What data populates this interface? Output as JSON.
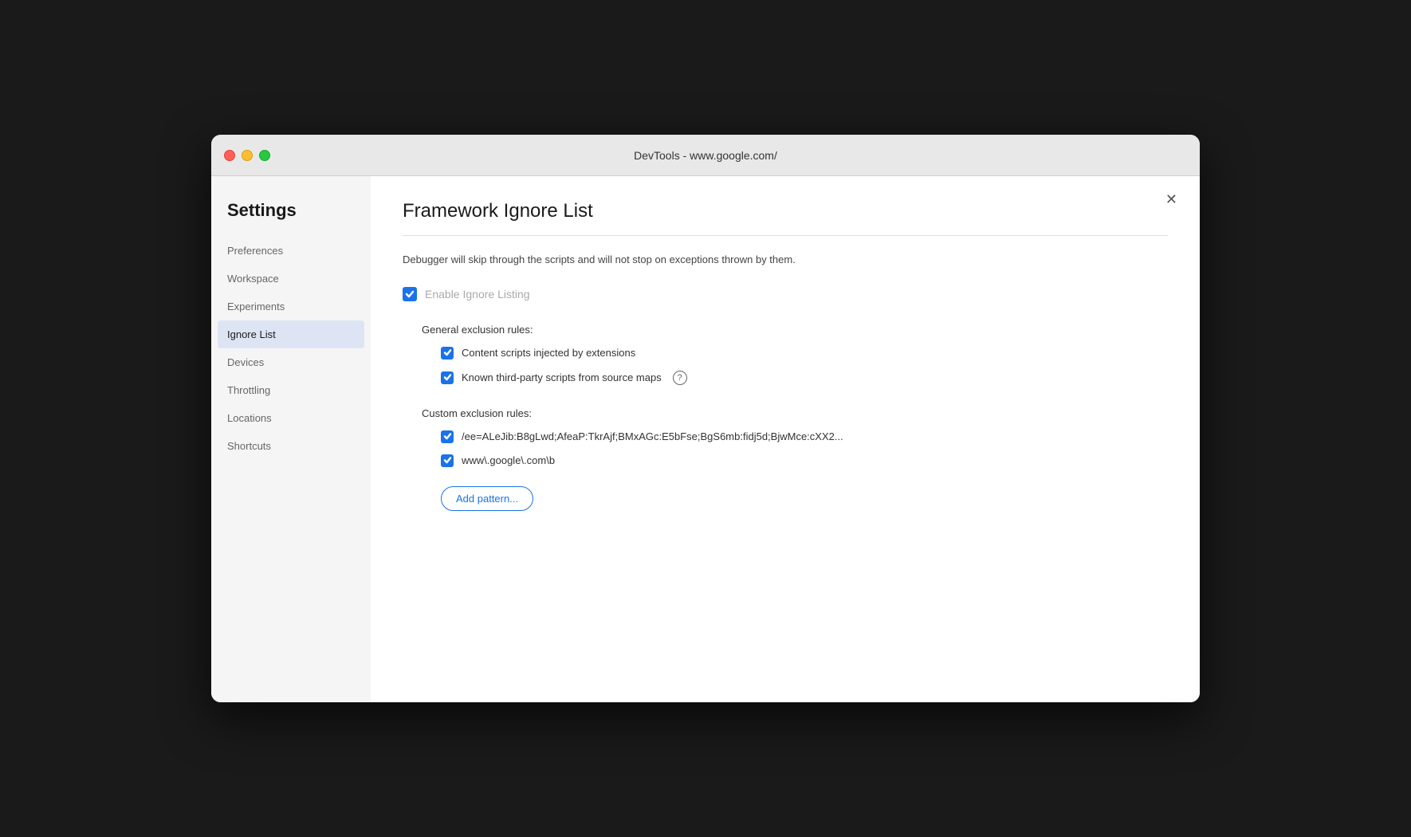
{
  "titlebar": {
    "title": "DevTools - www.google.com/"
  },
  "sidebar": {
    "heading": "Settings",
    "items": [
      {
        "id": "preferences",
        "label": "Preferences",
        "active": false
      },
      {
        "id": "workspace",
        "label": "Workspace",
        "active": false
      },
      {
        "id": "experiments",
        "label": "Experiments",
        "active": false
      },
      {
        "id": "ignore-list",
        "label": "Ignore List",
        "active": true
      },
      {
        "id": "devices",
        "label": "Devices",
        "active": false
      },
      {
        "id": "throttling",
        "label": "Throttling",
        "active": false
      },
      {
        "id": "locations",
        "label": "Locations",
        "active": false
      },
      {
        "id": "shortcuts",
        "label": "Shortcuts",
        "active": false
      }
    ]
  },
  "main": {
    "title": "Framework Ignore List",
    "description": "Debugger will skip through the scripts and will not stop on exceptions thrown by them.",
    "enable_ignore_listing_label": "Enable Ignore Listing",
    "general_exclusion_label": "General exclusion rules:",
    "general_rules": [
      {
        "id": "content-scripts",
        "label": "Content scripts injected by extensions",
        "checked": true,
        "has_info": false
      },
      {
        "id": "third-party-scripts",
        "label": "Known third-party scripts from source maps",
        "checked": true,
        "has_info": true
      }
    ],
    "custom_exclusion_label": "Custom exclusion rules:",
    "custom_rules": [
      {
        "id": "custom-rule-1",
        "label": "/ee=ALeJib:B8gLwd;AfeaP:TkrAjf;BMxAGc:E5bFse;BgS6mb:fidj5d;BjwMce:cXX2...",
        "checked": true
      },
      {
        "id": "custom-rule-2",
        "label": "www\\.google\\.com\\b",
        "checked": true
      }
    ],
    "add_pattern_label": "Add pattern..."
  }
}
